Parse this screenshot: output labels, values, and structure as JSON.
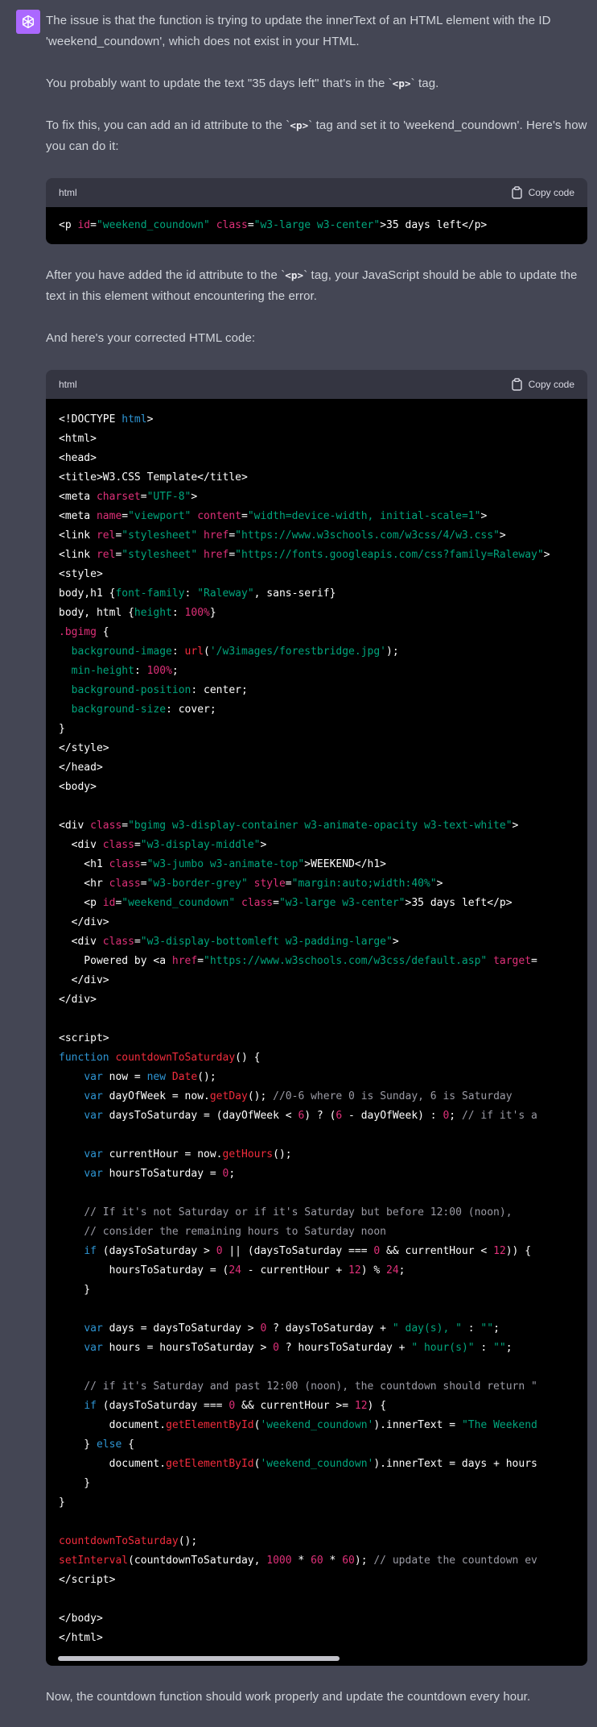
{
  "colors": {
    "page_background": "#444654",
    "avatar_background": "#ab68ff",
    "paragraph_text": "#d1d5db",
    "code_background": "#000000",
    "code_header_background": "#343541",
    "scrollbar": "#c1c1c9",
    "w": "#ffffff",
    "b": "#2e95d3",
    "g": "#00a67d",
    "p": "#df3079",
    "r": "#f22c3d",
    "c": "#9b9ba5"
  },
  "avatar": {
    "icon": "openai-logo"
  },
  "paragraphs": [
    {
      "segments": [
        {
          "text": "The issue is that the function is trying to update the innerText of an HTML element with the ID 'weekend_coundown', which does not exist in your HTML."
        }
      ]
    },
    {
      "segments": [
        {
          "text": "You probably want to update the text \"35 days left\" that's in the `"
        },
        {
          "code": "<p>"
        },
        {
          "text": "` tag."
        }
      ]
    },
    {
      "segments": [
        {
          "text": "To fix this, you can add an id attribute to the `"
        },
        {
          "code": "<p>"
        },
        {
          "text": "` tag and set it to 'weekend_coundown'. Here's how you can do it:"
        }
      ]
    },
    {
      "segments": [
        {
          "text": "After you have added the id attribute to the `"
        },
        {
          "code": "<p>"
        },
        {
          "text": "` tag, your JavaScript should be able to update the text in this element without encountering the error."
        }
      ]
    },
    {
      "segments": [
        {
          "text": "And here's your corrected HTML code:"
        }
      ]
    },
    {
      "segments": [
        {
          "text": "Now, the countdown function should work properly and update the countdown every hour."
        }
      ]
    }
  ],
  "code_blocks": [
    {
      "language": "html",
      "copy_label": "Copy code",
      "lines": [
        [
          [
            "w",
            "<p "
          ],
          [
            "p",
            "id"
          ],
          [
            "w",
            "="
          ],
          [
            "g",
            "\"weekend_coundown\""
          ],
          [
            "w",
            " "
          ],
          [
            "p",
            "class"
          ],
          [
            "w",
            "="
          ],
          [
            "g",
            "\"w3-large w3-center\""
          ],
          [
            "w",
            ">35 days left</p>"
          ]
        ]
      ]
    },
    {
      "language": "html",
      "copy_label": "Copy code",
      "lines": [
        [
          [
            "w",
            "<!DOCTYPE "
          ],
          [
            "b",
            "html"
          ],
          [
            "w",
            ">"
          ]
        ],
        [
          [
            "w",
            "<html>"
          ]
        ],
        [
          [
            "w",
            "<head>"
          ]
        ],
        [
          [
            "w",
            "<title>W3.CSS Template</title>"
          ]
        ],
        [
          [
            "w",
            "<meta "
          ],
          [
            "p",
            "charset"
          ],
          [
            "w",
            "="
          ],
          [
            "g",
            "\"UTF-8\""
          ],
          [
            "w",
            ">"
          ]
        ],
        [
          [
            "w",
            "<meta "
          ],
          [
            "p",
            "name"
          ],
          [
            "w",
            "="
          ],
          [
            "g",
            "\"viewport\""
          ],
          [
            "w",
            " "
          ],
          [
            "p",
            "content"
          ],
          [
            "w",
            "="
          ],
          [
            "g",
            "\"width=device-width, initial-scale=1\""
          ],
          [
            "w",
            ">"
          ]
        ],
        [
          [
            "w",
            "<link "
          ],
          [
            "p",
            "rel"
          ],
          [
            "w",
            "="
          ],
          [
            "g",
            "\"stylesheet\""
          ],
          [
            "w",
            " "
          ],
          [
            "p",
            "href"
          ],
          [
            "w",
            "="
          ],
          [
            "g",
            "\"https://www.w3schools.com/w3css/4/w3.css\""
          ],
          [
            "w",
            ">"
          ]
        ],
        [
          [
            "w",
            "<link "
          ],
          [
            "p",
            "rel"
          ],
          [
            "w",
            "="
          ],
          [
            "g",
            "\"stylesheet\""
          ],
          [
            "w",
            " "
          ],
          [
            "p",
            "href"
          ],
          [
            "w",
            "="
          ],
          [
            "g",
            "\"https://fonts.googleapis.com/css?family=Raleway\""
          ],
          [
            "w",
            ">"
          ]
        ],
        [
          [
            "w",
            "<style>"
          ]
        ],
        [
          [
            "w",
            "body,h1 {"
          ],
          [
            "g",
            "font-family"
          ],
          [
            "w",
            ": "
          ],
          [
            "g",
            "\"Raleway\""
          ],
          [
            "w",
            ", sans-serif}"
          ]
        ],
        [
          [
            "w",
            "body, html {"
          ],
          [
            "g",
            "height"
          ],
          [
            "w",
            ": "
          ],
          [
            "p",
            "100%"
          ],
          [
            "w",
            "}"
          ]
        ],
        [
          [
            "p",
            ".bgimg"
          ],
          [
            "w",
            " {"
          ]
        ],
        [
          [
            "w",
            "  "
          ],
          [
            "g",
            "background-image"
          ],
          [
            "w",
            ": "
          ],
          [
            "r",
            "url"
          ],
          [
            "w",
            "("
          ],
          [
            "g",
            "'/w3images/forestbridge.jpg'"
          ],
          [
            "w",
            ");"
          ]
        ],
        [
          [
            "w",
            "  "
          ],
          [
            "g",
            "min-height"
          ],
          [
            "w",
            ": "
          ],
          [
            "p",
            "100%"
          ],
          [
            "w",
            ";"
          ]
        ],
        [
          [
            "w",
            "  "
          ],
          [
            "g",
            "background-position"
          ],
          [
            "w",
            ": center;"
          ]
        ],
        [
          [
            "w",
            "  "
          ],
          [
            "g",
            "background-size"
          ],
          [
            "w",
            ": cover;"
          ]
        ],
        [
          [
            "w",
            "}"
          ]
        ],
        [
          [
            "w",
            "</style>"
          ]
        ],
        [
          [
            "w",
            "</head>"
          ]
        ],
        [
          [
            "w",
            "<body>"
          ]
        ],
        [],
        [
          [
            "w",
            "<div "
          ],
          [
            "p",
            "class"
          ],
          [
            "w",
            "="
          ],
          [
            "g",
            "\"bgimg w3-display-container w3-animate-opacity w3-text-white\""
          ],
          [
            "w",
            ">"
          ]
        ],
        [
          [
            "w",
            "  <div "
          ],
          [
            "p",
            "class"
          ],
          [
            "w",
            "="
          ],
          [
            "g",
            "\"w3-display-middle\""
          ],
          [
            "w",
            ">"
          ]
        ],
        [
          [
            "w",
            "    <h1 "
          ],
          [
            "p",
            "class"
          ],
          [
            "w",
            "="
          ],
          [
            "g",
            "\"w3-jumbo w3-animate-top\""
          ],
          [
            "w",
            ">WEEKEND</h1>"
          ]
        ],
        [
          [
            "w",
            "    <hr "
          ],
          [
            "p",
            "class"
          ],
          [
            "w",
            "="
          ],
          [
            "g",
            "\"w3-border-grey\""
          ],
          [
            "w",
            " "
          ],
          [
            "p",
            "style"
          ],
          [
            "w",
            "="
          ],
          [
            "g",
            "\"margin:auto;width:40%\""
          ],
          [
            "w",
            ">"
          ]
        ],
        [
          [
            "w",
            "    <p "
          ],
          [
            "p",
            "id"
          ],
          [
            "w",
            "="
          ],
          [
            "g",
            "\"weekend_coundown\""
          ],
          [
            "w",
            " "
          ],
          [
            "p",
            "class"
          ],
          [
            "w",
            "="
          ],
          [
            "g",
            "\"w3-large w3-center\""
          ],
          [
            "w",
            ">35 days left</p>"
          ]
        ],
        [
          [
            "w",
            "  </div>"
          ]
        ],
        [
          [
            "w",
            "  <div "
          ],
          [
            "p",
            "class"
          ],
          [
            "w",
            "="
          ],
          [
            "g",
            "\"w3-display-bottomleft w3-padding-large\""
          ],
          [
            "w",
            ">"
          ]
        ],
        [
          [
            "w",
            "    Powered by <a "
          ],
          [
            "p",
            "href"
          ],
          [
            "w",
            "="
          ],
          [
            "g",
            "\"https://www.w3schools.com/w3css/default.asp\""
          ],
          [
            "w",
            " "
          ],
          [
            "p",
            "target"
          ],
          [
            "w",
            "="
          ]
        ],
        [
          [
            "w",
            "  </div>"
          ]
        ],
        [
          [
            "w",
            "</div>"
          ]
        ],
        [],
        [
          [
            "w",
            "<script>"
          ]
        ],
        [
          [
            "b",
            "function"
          ],
          [
            "w",
            " "
          ],
          [
            "r",
            "countdownToSaturday"
          ],
          [
            "w",
            "() {"
          ]
        ],
        [
          [
            "w",
            "    "
          ],
          [
            "b",
            "var"
          ],
          [
            "w",
            " now = "
          ],
          [
            "b",
            "new"
          ],
          [
            "w",
            " "
          ],
          [
            "r",
            "Date"
          ],
          [
            "w",
            "();"
          ]
        ],
        [
          [
            "w",
            "    "
          ],
          [
            "b",
            "var"
          ],
          [
            "w",
            " dayOfWeek = now."
          ],
          [
            "r",
            "getDay"
          ],
          [
            "w",
            "(); "
          ],
          [
            "c",
            "//0-6 where 0 is Sunday, 6 is Saturday"
          ]
        ],
        [
          [
            "w",
            "    "
          ],
          [
            "b",
            "var"
          ],
          [
            "w",
            " daysToSaturday = (dayOfWeek < "
          ],
          [
            "p",
            "6"
          ],
          [
            "w",
            ") ? ("
          ],
          [
            "p",
            "6"
          ],
          [
            "w",
            " - dayOfWeek) : "
          ],
          [
            "p",
            "0"
          ],
          [
            "w",
            "; "
          ],
          [
            "c",
            "// if it's a"
          ]
        ],
        [],
        [
          [
            "w",
            "    "
          ],
          [
            "b",
            "var"
          ],
          [
            "w",
            " currentHour = now."
          ],
          [
            "r",
            "getHours"
          ],
          [
            "w",
            "();"
          ]
        ],
        [
          [
            "w",
            "    "
          ],
          [
            "b",
            "var"
          ],
          [
            "w",
            " hoursToSaturday = "
          ],
          [
            "p",
            "0"
          ],
          [
            "w",
            ";"
          ]
        ],
        [],
        [
          [
            "w",
            "    "
          ],
          [
            "c",
            "// If it's not Saturday or if it's Saturday but before 12:00 (noon),"
          ]
        ],
        [
          [
            "w",
            "    "
          ],
          [
            "c",
            "// consider the remaining hours to Saturday noon"
          ]
        ],
        [
          [
            "w",
            "    "
          ],
          [
            "b",
            "if"
          ],
          [
            "w",
            " (daysToSaturday > "
          ],
          [
            "p",
            "0"
          ],
          [
            "w",
            " || (daysToSaturday === "
          ],
          [
            "p",
            "0"
          ],
          [
            "w",
            " && currentHour < "
          ],
          [
            "p",
            "12"
          ],
          [
            "w",
            ")) {"
          ]
        ],
        [
          [
            "w",
            "        hoursToSaturday = ("
          ],
          [
            "p",
            "24"
          ],
          [
            "w",
            " - currentHour + "
          ],
          [
            "p",
            "12"
          ],
          [
            "w",
            ") % "
          ],
          [
            "p",
            "24"
          ],
          [
            "w",
            ";"
          ]
        ],
        [
          [
            "w",
            "    }"
          ]
        ],
        [],
        [
          [
            "w",
            "    "
          ],
          [
            "b",
            "var"
          ],
          [
            "w",
            " days = daysToSaturday > "
          ],
          [
            "p",
            "0"
          ],
          [
            "w",
            " ? daysToSaturday + "
          ],
          [
            "g",
            "\" day(s), \""
          ],
          [
            "w",
            " : "
          ],
          [
            "g",
            "\"\""
          ],
          [
            "w",
            ";"
          ]
        ],
        [
          [
            "w",
            "    "
          ],
          [
            "b",
            "var"
          ],
          [
            "w",
            " hours = hoursToSaturday > "
          ],
          [
            "p",
            "0"
          ],
          [
            "w",
            " ? hoursToSaturday + "
          ],
          [
            "g",
            "\" hour(s)\""
          ],
          [
            "w",
            " : "
          ],
          [
            "g",
            "\"\""
          ],
          [
            "w",
            ";"
          ]
        ],
        [],
        [
          [
            "w",
            "    "
          ],
          [
            "c",
            "// if it's Saturday and past 12:00 (noon), the countdown should return \""
          ]
        ],
        [
          [
            "w",
            "    "
          ],
          [
            "b",
            "if"
          ],
          [
            "w",
            " (daysToSaturday === "
          ],
          [
            "p",
            "0"
          ],
          [
            "w",
            " && currentHour >= "
          ],
          [
            "p",
            "12"
          ],
          [
            "w",
            ") {"
          ]
        ],
        [
          [
            "w",
            "        document."
          ],
          [
            "r",
            "getElementById"
          ],
          [
            "w",
            "("
          ],
          [
            "g",
            "'weekend_coundown'"
          ],
          [
            "w",
            ").innerText = "
          ],
          [
            "g",
            "\"The Weekend"
          ]
        ],
        [
          [
            "w",
            "    } "
          ],
          [
            "b",
            "else"
          ],
          [
            "w",
            " {"
          ]
        ],
        [
          [
            "w",
            "        document."
          ],
          [
            "r",
            "getElementById"
          ],
          [
            "w",
            "("
          ],
          [
            "g",
            "'weekend_coundown'"
          ],
          [
            "w",
            ").innerText = days + hours"
          ]
        ],
        [
          [
            "w",
            "    }"
          ]
        ],
        [
          [
            "w",
            "}"
          ]
        ],
        [],
        [
          [
            "r",
            "countdownToSaturday"
          ],
          [
            "w",
            "();"
          ]
        ],
        [
          [
            "r",
            "setInterval"
          ],
          [
            "w",
            "(countdownToSaturday, "
          ],
          [
            "p",
            "1000"
          ],
          [
            "w",
            " * "
          ],
          [
            "p",
            "60"
          ],
          [
            "w",
            " * "
          ],
          [
            "p",
            "60"
          ],
          [
            "w",
            "); "
          ],
          [
            "c",
            "// update the countdown ev"
          ]
        ],
        [
          [
            "w",
            "</script>"
          ]
        ],
        [],
        [
          [
            "w",
            "</body>"
          ]
        ],
        [
          [
            "w",
            "</html>"
          ]
        ]
      ]
    }
  ]
}
